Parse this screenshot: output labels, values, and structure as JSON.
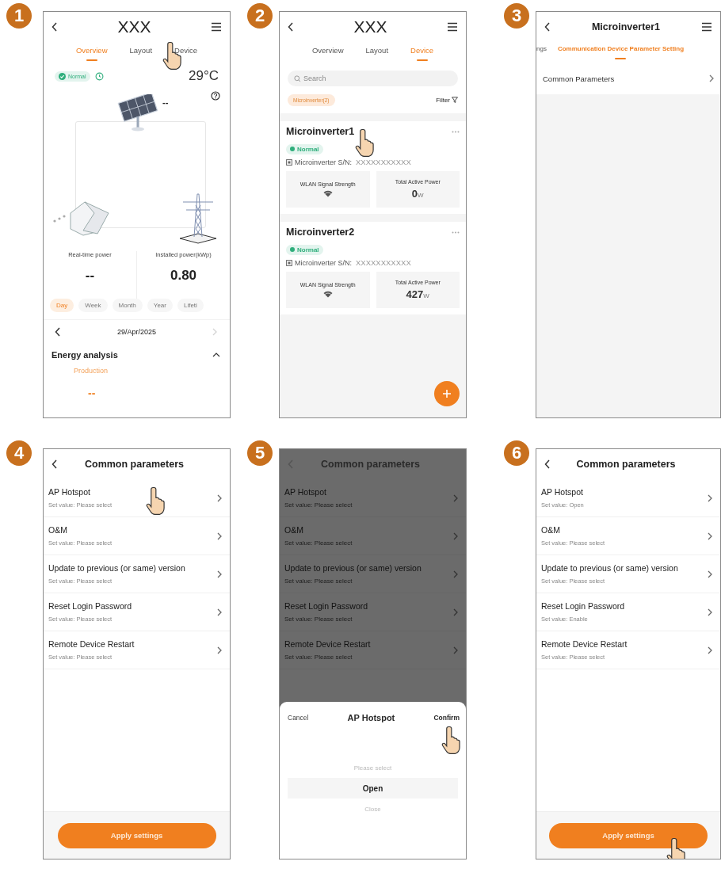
{
  "steps": [
    {
      "number": "1",
      "kind": "overview",
      "header": {
        "title": "XXX"
      },
      "tabs": [
        {
          "label": "Overview",
          "selected": true
        },
        {
          "label": "Layout",
          "selected": false
        },
        {
          "label": "Device",
          "selected": false
        }
      ],
      "status": "Normal",
      "temperature": "29°C",
      "pv_reading": "--",
      "stats": [
        {
          "label": "Real-time power",
          "value": "--"
        },
        {
          "label": "Installed power(kWp)",
          "value": "0.80"
        }
      ],
      "periods": [
        {
          "label": "Day",
          "selected": true
        },
        {
          "label": "Week",
          "selected": false
        },
        {
          "label": "Month",
          "selected": false
        },
        {
          "label": "Year",
          "selected": false
        },
        {
          "label": "Lifeti",
          "selected": false
        }
      ],
      "date": {
        "label": "29/Apr/2025",
        "next_enabled": false
      },
      "analysis": {
        "title": "Energy analysis",
        "expanded": true,
        "legend": "Production",
        "value": "--"
      }
    },
    {
      "number": "2",
      "kind": "devices",
      "header": {
        "title": "XXX"
      },
      "tabs": [
        {
          "label": "Overview",
          "selected": false
        },
        {
          "label": "Layout",
          "selected": false
        },
        {
          "label": "Device",
          "selected": true
        }
      ],
      "search": {
        "placeholder": "Search"
      },
      "filter_chip": {
        "label": "Microinverter(2)",
        "selected": true
      },
      "filter": "Filter",
      "devices": [
        {
          "name": "Microinverter1",
          "status": "Normal",
          "serial_label": "Microinverter S/N:",
          "serial": "XXXXXXXXXXX",
          "signal_label": "WLAN Signal Strength",
          "power_label": "Total Active Power",
          "power": "0",
          "unit": "W"
        },
        {
          "name": "Microinverter2",
          "status": "Normal",
          "serial_label": "Microinverter S/N:",
          "serial": "XXXXXXXXXXX",
          "signal_label": "WLAN Signal Strength",
          "power_label": "Total Active Power",
          "power": "427",
          "unit": "W"
        }
      ]
    },
    {
      "number": "3",
      "kind": "settings",
      "header": {
        "title": "Microinverter1"
      },
      "tabs": [
        {
          "label": "ngs",
          "selected": false
        },
        {
          "label": "Communication Device Parameter Setting",
          "selected": true
        }
      ],
      "items": [
        "Common Parameters"
      ]
    },
    {
      "number": "4",
      "kind": "parameters",
      "header": {
        "title": "Common parameters"
      },
      "dimmed": false,
      "params": [
        {
          "name": "AP Hotspot",
          "value": "Set value: Please select"
        },
        {
          "name": "O&M",
          "value": "Set value: Please select"
        },
        {
          "name": "Update to previous (or same) version",
          "value": "Set value: Please select"
        },
        {
          "name": "Reset Login Password",
          "value": "Set value: Please select"
        },
        {
          "name": "Remote Device Restart",
          "value": "Set value: Please select"
        }
      ],
      "apply": "Apply settings"
    },
    {
      "number": "5",
      "kind": "parameters",
      "header": {
        "title": "Common parameters"
      },
      "dimmed": true,
      "params": [
        {
          "name": "AP Hotspot",
          "value": "Set value: Please select"
        },
        {
          "name": "O&M",
          "value": "Set value: Please select"
        },
        {
          "name": "Update to previous (or same) version",
          "value": "Set value: Please select"
        },
        {
          "name": "Reset Login Password",
          "value": "Set value: Please select"
        },
        {
          "name": "Remote Device Restart",
          "value": "Set value: Please select"
        }
      ],
      "sheet": {
        "cancel": "Cancel",
        "title": "AP Hotspot",
        "confirm": "Confirm",
        "options": [
          {
            "label": "Please select",
            "selected": false
          },
          {
            "label": "Open",
            "selected": true
          },
          {
            "label": "Close",
            "selected": false
          }
        ]
      }
    },
    {
      "number": "6",
      "kind": "parameters",
      "header": {
        "title": "Common parameters"
      },
      "dimmed": false,
      "params": [
        {
          "name": "AP Hotspot",
          "value": "Set value: Open"
        },
        {
          "name": "O&M",
          "value": "Set value: Please select"
        },
        {
          "name": "Update to previous (or same) version",
          "value": "Set value: Please select"
        },
        {
          "name": "Reset Login Password",
          "value": "Set value: Enable"
        },
        {
          "name": "Remote Device Restart",
          "value": "Set value: Please select"
        }
      ],
      "apply": "Apply settings"
    }
  ]
}
